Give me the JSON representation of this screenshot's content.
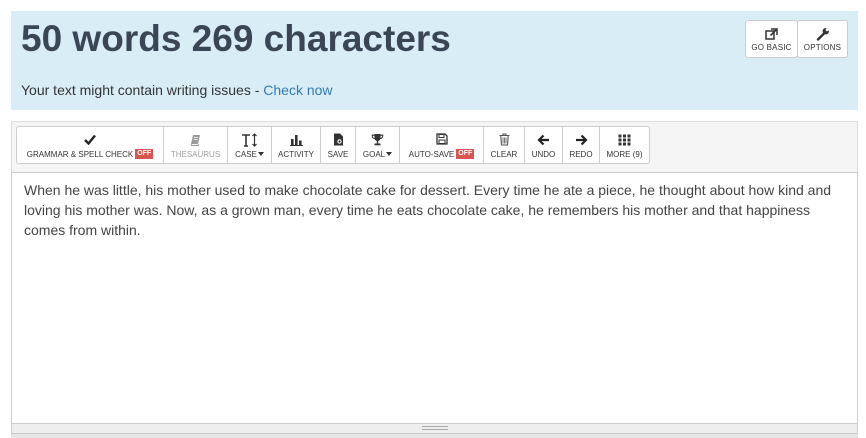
{
  "header": {
    "counts_text": "50 words 269 characters",
    "issues_text": "Your text might contain writing issues - ",
    "check_link": "Check now",
    "go_basic_label": "GO BASIC",
    "options_label": "OPTIONS"
  },
  "toolbar": {
    "items": [
      {
        "label": "GRAMMAR & SPELL CHECK",
        "icon": "check-icon",
        "badge": "OFF"
      },
      {
        "label": "THESAURUS",
        "icon": "book-icon",
        "disabled": true
      },
      {
        "label": "CASE",
        "icon": "text-height-icon",
        "dropdown": true
      },
      {
        "label": "ACTIVITY",
        "icon": "bar-chart-icon"
      },
      {
        "label": "SAVE",
        "icon": "save-file-icon"
      },
      {
        "label": "GOAL",
        "icon": "trophy-icon",
        "dropdown": true
      },
      {
        "label": "AUTO-SAVE",
        "icon": "floppy-disk-icon",
        "badge": "OFF"
      },
      {
        "label": "CLEAR",
        "icon": "trash-icon"
      },
      {
        "label": "UNDO",
        "icon": "arrow-left-icon"
      },
      {
        "label": "REDO",
        "icon": "arrow-right-icon"
      },
      {
        "label": "MORE (9)",
        "icon": "grid-icon"
      }
    ],
    "badge_color": "#d9534f"
  },
  "editor": {
    "text": "When he was little, his mother used to make chocolate cake for dessert. Every time he ate a piece, he thought about how kind and loving his mother was. Now, as a grown man, every time he eats chocolate cake, he remembers his mother and that happiness comes from within."
  },
  "colors": {
    "header_bg": "#d9edf7",
    "title": "#3a4656",
    "link": "#337ab7"
  }
}
